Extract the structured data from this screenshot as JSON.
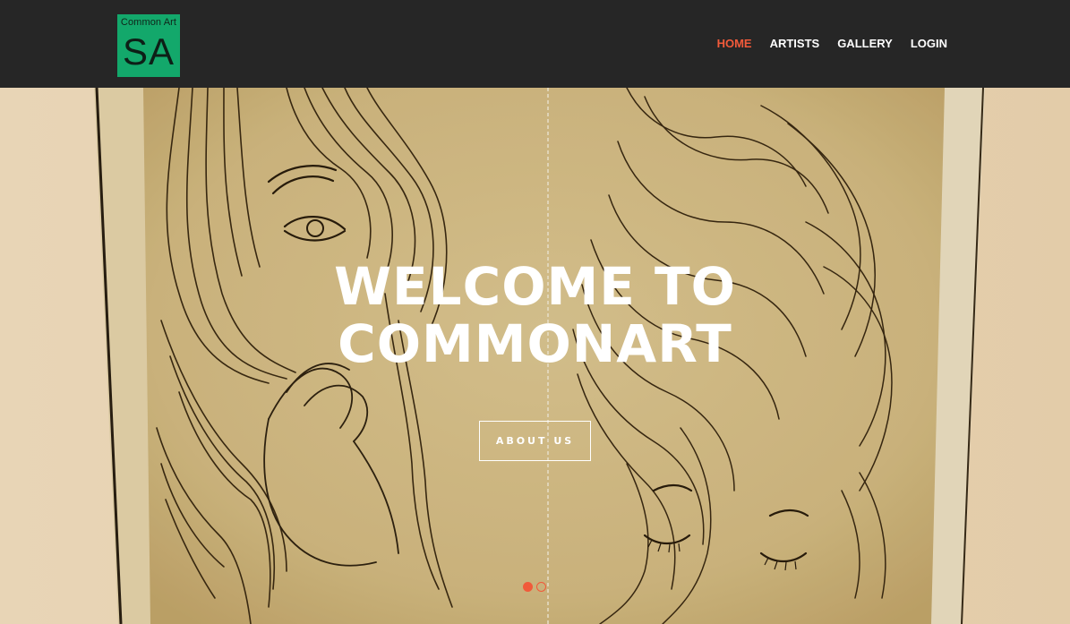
{
  "brand": {
    "small_text": "Common Art",
    "initials": "SA",
    "color": "#13a86b"
  },
  "nav": {
    "items": [
      {
        "label": "HOME",
        "active": true
      },
      {
        "label": "ARTISTS",
        "active": false
      },
      {
        "label": "GALLERY",
        "active": false
      },
      {
        "label": "LOGIN",
        "active": false
      }
    ],
    "active_color": "#f15a3a",
    "background": "#262626"
  },
  "hero": {
    "title_line1": "WELCOME TO",
    "title_line2": "COMMONART",
    "button_label": "ABOUT US",
    "slides": {
      "count": 2,
      "current": 1
    }
  }
}
